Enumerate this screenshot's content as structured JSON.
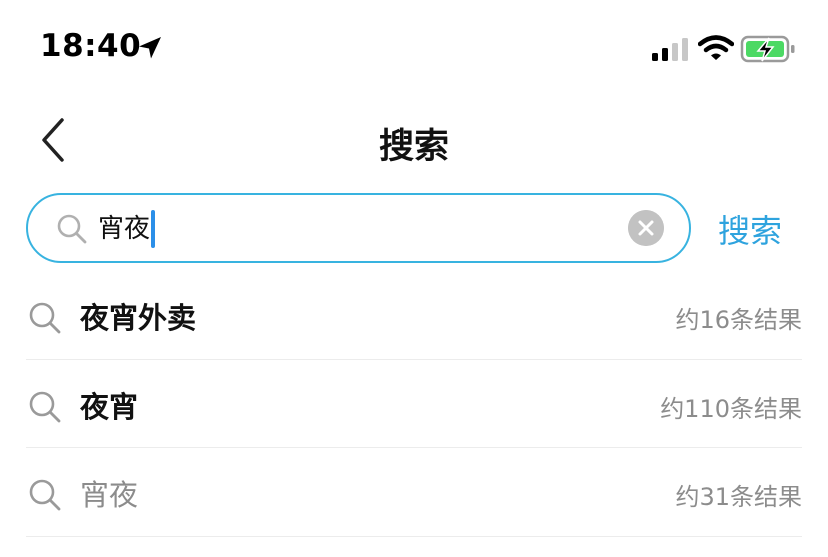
{
  "status_bar": {
    "time": "18:40",
    "icons": [
      "location-arrow-icon",
      "signal-icon",
      "wifi-icon",
      "battery-charging-icon"
    ],
    "battery_color": "#4cd964"
  },
  "nav": {
    "title": "搜索",
    "back_icon": "chevron-left-icon"
  },
  "search": {
    "value": "宵夜",
    "action_label": "搜索",
    "accent_color": "#38b3e0"
  },
  "suggestions": [
    {
      "text": "夜宵外卖",
      "count": "约16条结果",
      "style": "bold"
    },
    {
      "text": "夜宵",
      "count": "约110条结果",
      "style": "bold"
    },
    {
      "text": "宵夜",
      "count": "约31条结果",
      "style": "muted"
    }
  ]
}
